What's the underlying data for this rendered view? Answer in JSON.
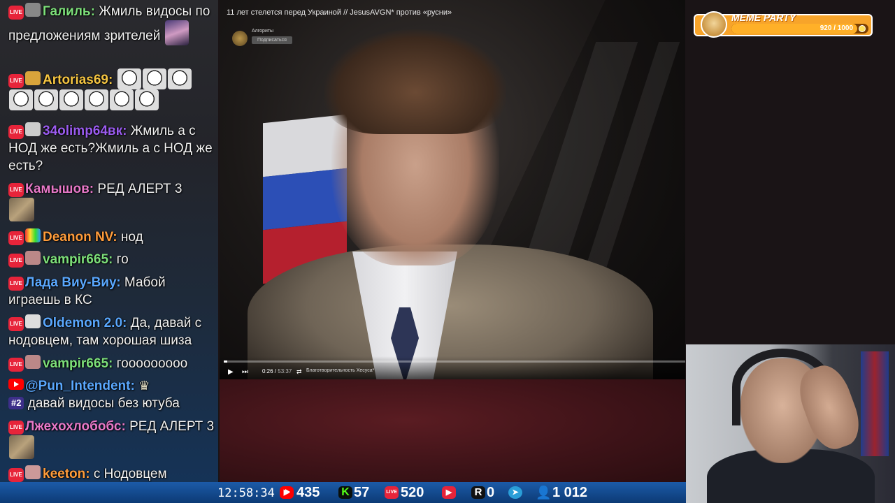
{
  "chat": {
    "messages": [
      {
        "platform": "live",
        "nick": "Галиль:",
        "nick_color": "#7de07a",
        "text": "Жмиль видосы по предложениям зрителей",
        "emote": "anime"
      },
      {
        "platform": "live",
        "nick": "Artorias69:",
        "nick_color": "#f5c542",
        "text": "",
        "emote": "joker x9"
      },
      {
        "platform": "live",
        "nick": "34olimp64вк:",
        "nick_color": "#9b5cf0",
        "text": "Жмиль а с НОД же есть?Жмиль а с НОД же есть?"
      },
      {
        "platform": "live",
        "nick": "Камышов:",
        "nick_color": "#e879c9",
        "text": "РЕД АЛЕРТ 3",
        "emote": "cat"
      },
      {
        "platform": "live",
        "nick": "Deanon NV:",
        "nick_color": "#ff9c3b",
        "text": "нод"
      },
      {
        "platform": "live",
        "nick": "vampir665:",
        "nick_color": "#7de07a",
        "text": "го"
      },
      {
        "platform": "live",
        "nick": "Лада Виу-Виу:",
        "nick_color": "#5aa8ff",
        "text": "Мабой играешь в КС"
      },
      {
        "platform": "live",
        "nick": "Oldemon 2.0:",
        "nick_color": "#5aa8ff",
        "text": "Да, давай с нодовцем, там хорошая шиза"
      },
      {
        "platform": "live",
        "nick": "vampir665:",
        "nick_color": "#7de07a",
        "text": "гоооооoooo"
      },
      {
        "platform": "youtube",
        "nick": "@Pun_Intendent:",
        "nick_color": "#5aa8ff",
        "text": "давай видосы без ютуба",
        "badge": "#2"
      },
      {
        "platform": "live",
        "nick": "Лжехохлобобс:",
        "nick_color": "#e879c9",
        "text": "РЕД АЛЕРТ 3"
      },
      {
        "platform": "live",
        "nick": "keeton:",
        "nick_color": "#ff9c3b",
        "text": "с Нодовцем платина"
      }
    ]
  },
  "video": {
    "title": "11 лет стелется перед Украиной // JesusAVGN* против «русни»",
    "channel": "Алгориты",
    "subscribe_label": "Подписаться",
    "current_time": "0:26",
    "duration": "53:37",
    "chapter": "Благотворительность Хесуса*",
    "progress": 0.008
  },
  "meme_party": {
    "title": "MEME PARTY",
    "current": 920,
    "max": 1000,
    "count_label": "920 / 1000",
    "accent": "#f7a42a"
  },
  "stats": {
    "clock": "12:58:34",
    "youtube": "435",
    "kick": "57",
    "live": "520",
    "twitch": "",
    "rumble": "0",
    "telegram": "",
    "viewers": "1 012"
  }
}
